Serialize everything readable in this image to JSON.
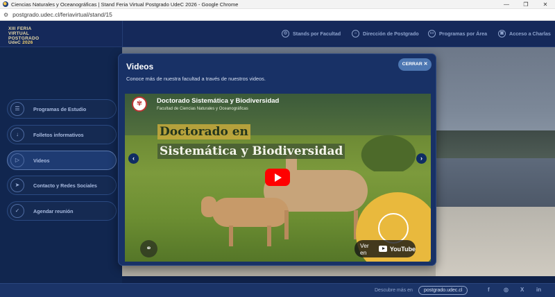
{
  "browser": {
    "window_title": "Ciencias Naturales y Oceanográficas | Stand Feria Virtual Postgrado UdeC 2026 - Google Chrome",
    "url": "postgrado.udec.cl/feriavirtual/stand/15",
    "controls": [
      "—",
      "❐",
      "✕"
    ]
  },
  "logo": {
    "line1": "XIII FERIA",
    "line2": "VIRTUAL",
    "line3": "POSTGRADO",
    "line4": "UdeC",
    "year": "2026"
  },
  "topnav": [
    {
      "label": "Stands por Facultad",
      "icon": "compass-icon"
    },
    {
      "label": "Dirección de Postgrado",
      "icon": "home-icon"
    },
    {
      "label": "Programas por Área",
      "icon": "folder-icon"
    },
    {
      "label": "Acceso a Charlas",
      "icon": "presentation-icon"
    }
  ],
  "sidebar": [
    {
      "label": "Programas de Estudio",
      "icon": "document-icon",
      "glyph": "☰"
    },
    {
      "label": "Folletos informativos",
      "icon": "download-icon",
      "glyph": "↓"
    },
    {
      "label": "Videos",
      "icon": "play-icon",
      "glyph": "▷"
    },
    {
      "label": "Contacto y Redes Sociales",
      "icon": "send-icon",
      "glyph": "➤"
    },
    {
      "label": "Agendar reunión",
      "icon": "check-icon",
      "glyph": "✓"
    }
  ],
  "modal": {
    "title": "Videos",
    "subtitle": "Conoce más de nuestra facultad a través de nuestros videos.",
    "close_label": "CERRAR ✕",
    "video": {
      "channel_title": "Doctorado Sistemática y Biodiversidad",
      "faculty": "Facultad de Ciencias Naturales y Oceanográficas",
      "headline1": "Doctorado en",
      "headline2": "Sistemática y Biodiversidad",
      "watch_on": "Ver en",
      "youtube": "YouTube",
      "prev": "‹",
      "next": "›",
      "link": "⚭"
    }
  },
  "footer": {
    "discover": "Descubre más en",
    "site": "postgrado.udec.cl",
    "social": [
      "f",
      "◎",
      "X",
      "in"
    ]
  }
}
